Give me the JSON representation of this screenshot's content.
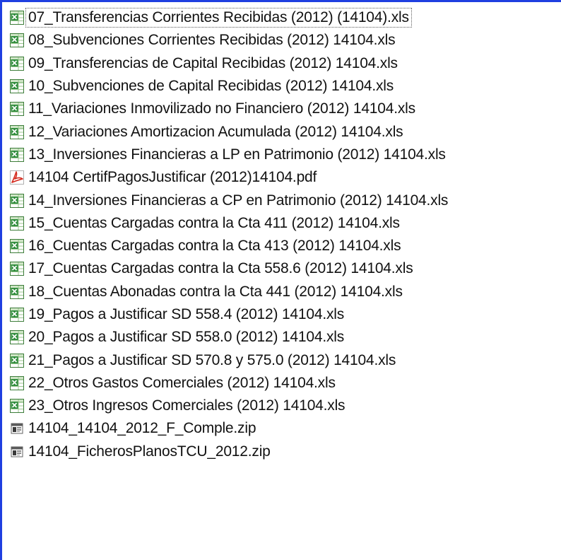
{
  "file_list": {
    "items": [
      {
        "name": "07_Transferencias Corrientes Recibidas (2012) (14104).xls",
        "icon": "excel-icon",
        "focused": true
      },
      {
        "name": "08_Subvenciones Corrientes Recibidas (2012) 14104.xls",
        "icon": "excel-icon"
      },
      {
        "name": "09_Transferencias de Capital Recibidas (2012) 14104.xls",
        "icon": "excel-icon"
      },
      {
        "name": "10_Subvenciones de Capital Recibidas (2012) 14104.xls",
        "icon": "excel-icon"
      },
      {
        "name": "11_Variaciones Inmovilizado no Financiero (2012) 14104.xls",
        "icon": "excel-icon"
      },
      {
        "name": "12_Variaciones Amortizacion Acumulada (2012) 14104.xls",
        "icon": "excel-icon"
      },
      {
        "name": "13_Inversiones Financieras a LP en Patrimonio (2012) 14104.xls",
        "icon": "excel-icon"
      },
      {
        "name": "14104 CertifPagosJustificar (2012)14104.pdf",
        "icon": "pdf-icon"
      },
      {
        "name": "14_Inversiones Financieras a CP en Patrimonio (2012) 14104.xls",
        "icon": "excel-icon"
      },
      {
        "name": "15_Cuentas Cargadas contra la Cta 411 (2012) 14104.xls",
        "icon": "excel-icon"
      },
      {
        "name": "16_Cuentas Cargadas contra la Cta 413 (2012) 14104.xls",
        "icon": "excel-icon"
      },
      {
        "name": "17_Cuentas Cargadas contra la Cta 558.6 (2012) 14104.xls",
        "icon": "excel-icon"
      },
      {
        "name": "18_Cuentas Abonadas contra la Cta 441 (2012) 14104.xls",
        "icon": "excel-icon"
      },
      {
        "name": "19_Pagos a Justificar SD 558.4 (2012) 14104.xls",
        "icon": "excel-icon"
      },
      {
        "name": "20_Pagos a Justificar SD 558.0 (2012) 14104.xls",
        "icon": "excel-icon"
      },
      {
        "name": "21_Pagos a Justificar SD 570.8 y 575.0 (2012) 14104.xls",
        "icon": "excel-icon"
      },
      {
        "name": "22_Otros Gastos Comerciales (2012) 14104.xls",
        "icon": "excel-icon"
      },
      {
        "name": "23_Otros Ingresos Comerciales (2012) 14104.xls",
        "icon": "excel-icon"
      },
      {
        "name": "14104_14104_2012_F_Comple.zip",
        "icon": "zip-icon"
      },
      {
        "name": "14104_FicherosPlanosTCU_2012.zip",
        "icon": "zip-icon"
      }
    ]
  },
  "colors": {
    "window_border": "#1f3fe0",
    "text": "#111111",
    "excel_green": "#2e8b3a",
    "pdf_red": "#d42a1e"
  }
}
